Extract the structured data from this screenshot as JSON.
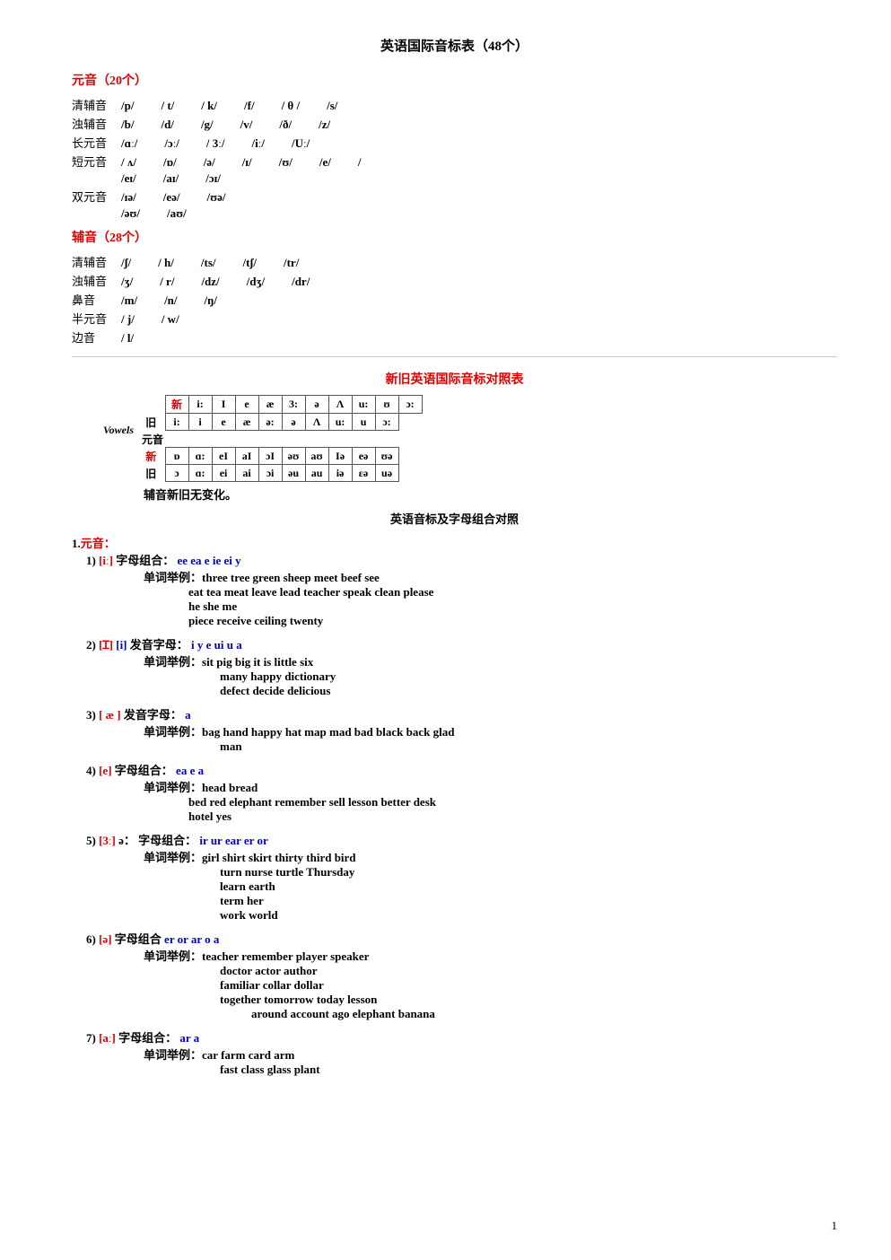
{
  "page": {
    "title": "英语国际音标表（48个）",
    "pageNum": "1"
  },
  "sections": {
    "yuanyin_title": "元音（20个）",
    "fuyin_title": "辅音（28个）",
    "compare_title": "新旧英语国际音标对照表",
    "combo_title": "英语音标及字母组合对照",
    "no_change": "辅音新旧无变化。"
  },
  "phonetics": {
    "qing_fuyin_label": "清辅音",
    "zhuo_fuyin_label": "浊辅音",
    "chang_yuanyin_label": "长元音",
    "duan_yuanyin_label": "短元音",
    "shuang_yuanyin_label": "双元音",
    "biyin_label": "鼻音",
    "banyuanyin_label": "半元音",
    "bianyin_label": "边音"
  },
  "examples": [
    {
      "num": "1",
      "phoneme": "[iː]",
      "combo_label": "字母组合：",
      "combos": "ee  ea  e  ie  ei  y",
      "examples": [
        "three  tree  green  sheep  meet  beef  see",
        "eat  tea  meat  leave  lead  teacher  speak  clean  please",
        "he  she  me",
        "piece   receive  ceiling  twenty"
      ]
    },
    {
      "num": "2",
      "phoneme": "[ɪ]",
      "alt_phoneme": "[i]",
      "combo_label": "发音字母：",
      "combos": "i  y  e  ui  u  a",
      "examples": [
        "sit  pig  big  it  is  little  six",
        "many  happy  dictionary",
        "defect  decide  delicious"
      ]
    },
    {
      "num": "3",
      "phoneme": "[æ]",
      "combo_label": "发音字母：",
      "combos": "a",
      "examples": [
        "bag  hand   happy  hat  map  mad  bad  black  back  glad",
        "man"
      ]
    },
    {
      "num": "4",
      "phoneme": "[e]",
      "combo_label": "字母组合：",
      "combos": "ea  e  a",
      "examples_label": "单词举例：",
      "examples": [
        "head  bread",
        "bed  red  elephant   remember  sell  lesson  better   desk",
        "hotel  yes"
      ]
    },
    {
      "num": "5",
      "phoneme": "[3ː]",
      "alt_phoneme": "ə：",
      "combo_label": "字母组合：",
      "combos": "ir  ur  ear er   or",
      "examples": [
        "girl  shirt  skirt  thirty   third   bird",
        "turn  nurse  turtle  Thursday",
        "learn  earth",
        "term  her",
        "work  world"
      ]
    },
    {
      "num": "6",
      "phoneme": "[ə]",
      "combo_label": "字母组合",
      "combos": "er  or  ar  o  a",
      "examples": [
        "teacher  remember  player  speaker",
        "doctor   actor   author",
        "familiar  collar  dollar",
        "together  tomorrow  today  lesson",
        "around  account  ago  elephant   banana"
      ]
    },
    {
      "num": "7",
      "phoneme": "[aː]",
      "combo_label": "字母组合：",
      "combos": "ar  a",
      "examples": [
        "car  farm  card  arm",
        "fast  class  glass  plant"
      ]
    }
  ]
}
